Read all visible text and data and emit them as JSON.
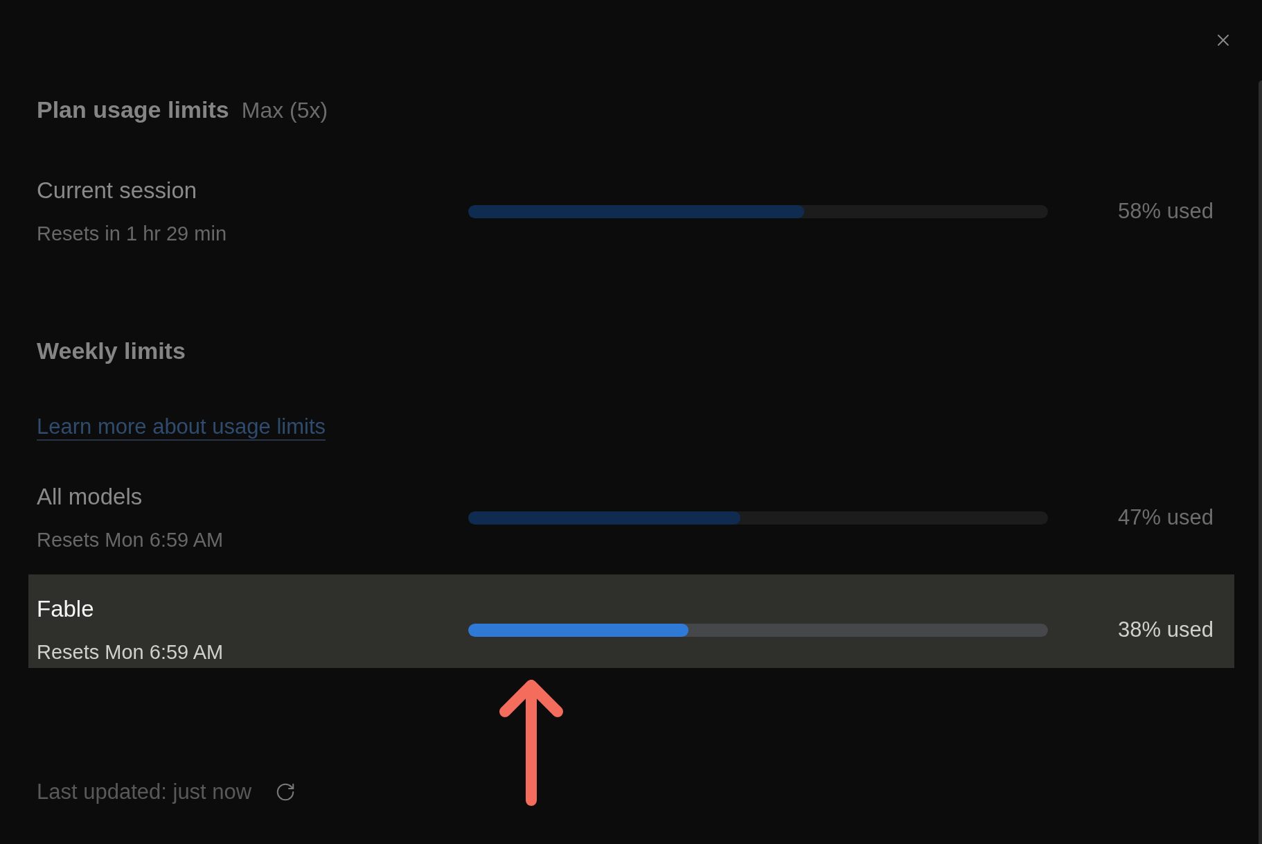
{
  "header": {
    "title": "Plan usage limits",
    "plan": "Max (5x)"
  },
  "session_limits": [
    {
      "name": "Current session",
      "resets": "Resets in 1 hr 29 min",
      "level": 0.58,
      "reading": "58% used",
      "highlighted": false
    }
  ],
  "weekly": {
    "title": "Weekly limits",
    "link": "Learn more about usage limits",
    "limits": [
      {
        "name": "All models",
        "resets": "Resets Mon 6:59 AM",
        "level": 0.47,
        "reading": "47% used",
        "highlighted": false
      },
      {
        "name": "Fable",
        "resets": "Resets Mon 6:59 AM",
        "level": 0.38,
        "reading": "38% used",
        "highlighted": true
      }
    ]
  },
  "footer": {
    "last_updated": "Last updated: just now"
  }
}
